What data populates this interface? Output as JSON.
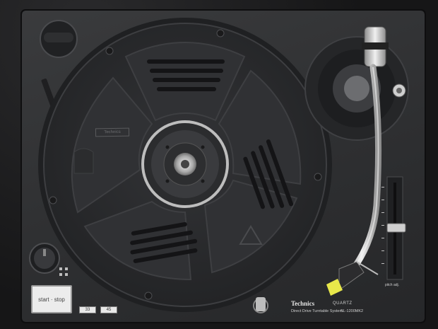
{
  "scene": {
    "subject": "Technics SL-1200MK2 turntable, top view"
  },
  "labels": {
    "start_stop": "start · stop",
    "speed_33": "33",
    "speed_45": "45",
    "brand": "Technics",
    "quartz": "QUARTZ",
    "subtitle": "Direct Drive Turntable System",
    "model": "SL-1200MK2",
    "pitch_adj": "pitch adj.",
    "platter_logo": "Technics"
  },
  "colors": {
    "deck": "#2e2f31",
    "platter": "#2a2b2d",
    "chrome": "#c9c9c9",
    "cartridge": "#e8e84a"
  }
}
